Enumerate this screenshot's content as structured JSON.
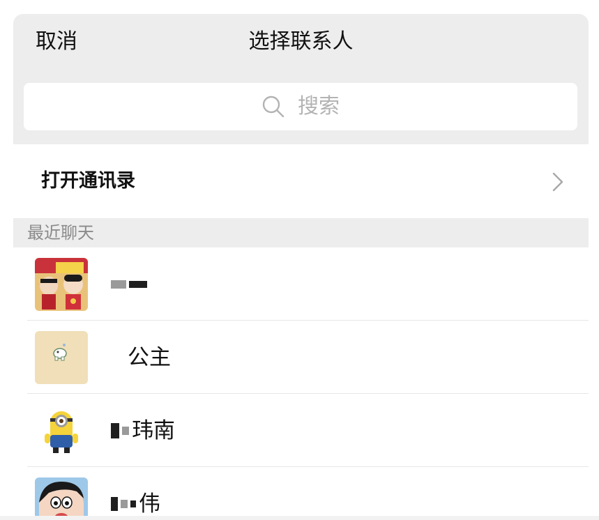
{
  "header": {
    "cancel_label": "取消",
    "title": "选择联系人"
  },
  "search": {
    "placeholder": "搜索",
    "icon": "search-icon"
  },
  "open_contacts": {
    "label": "打开通讯录",
    "icon": "chevron-right-icon"
  },
  "section": {
    "label": "最近聊天"
  },
  "contacts": [
    {
      "name": "■■■",
      "avatar": "doll-figurines-avatar"
    },
    {
      "name": "公主",
      "avatar": "elephant-sticker-avatar"
    },
    {
      "name": "玮南",
      "avatar": "minion-avatar"
    },
    {
      "name": "伟",
      "avatar": "cartoon-boy-avatar"
    }
  ],
  "colors": {
    "header_bg": "#ededed",
    "section_bg": "#ededed",
    "text_primary": "#111111",
    "text_placeholder": "#b3b3b3",
    "text_section": "#8a8a8a"
  }
}
